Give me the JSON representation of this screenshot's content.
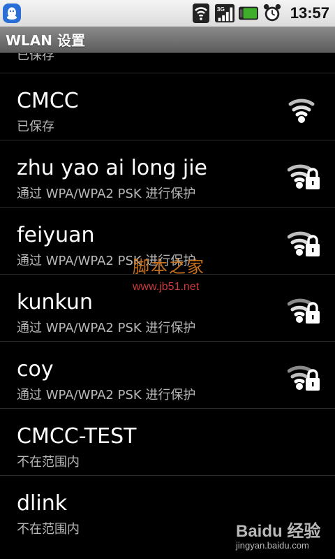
{
  "status_bar": {
    "time": "13:57",
    "icons": [
      "qq-icon",
      "wifi-status-icon",
      "3g-signal-icon",
      "battery-icon",
      "alarm-clock-icon"
    ],
    "battery_color": "#3fae2a"
  },
  "header": {
    "title": "WLAN 设置"
  },
  "networks": {
    "partial": {
      "status": "已保存"
    },
    "items": [
      {
        "ssid": "CMCC",
        "status": "已保存",
        "icon": "wifi-signal-icon"
      },
      {
        "ssid": "zhu yao ai long jie",
        "status": "通过 WPA/WPA2 PSK 进行保护",
        "icon": "wifi-locked-icon"
      },
      {
        "ssid": "feiyuan",
        "status": "通过 WPA/WPA2 PSK 进行保护",
        "icon": "wifi-locked-icon"
      },
      {
        "ssid": "kunkun",
        "status": "通过 WPA/WPA2 PSK 进行保护",
        "icon": "wifi-locked-icon"
      },
      {
        "ssid": "coy",
        "status": "通过 WPA/WPA2 PSK 进行保护",
        "icon": "wifi-locked-icon"
      },
      {
        "ssid": "CMCC-TEST",
        "status": "不在范围内",
        "icon": ""
      },
      {
        "ssid": "dlink",
        "status": "不在范围内",
        "icon": ""
      }
    ]
  },
  "watermarks": {
    "site_name": "脚本之家",
    "site_url": "www.jb51.net",
    "baidu_text": "Baidu 经验",
    "baidu_url": "jingyan.baidu.com"
  }
}
